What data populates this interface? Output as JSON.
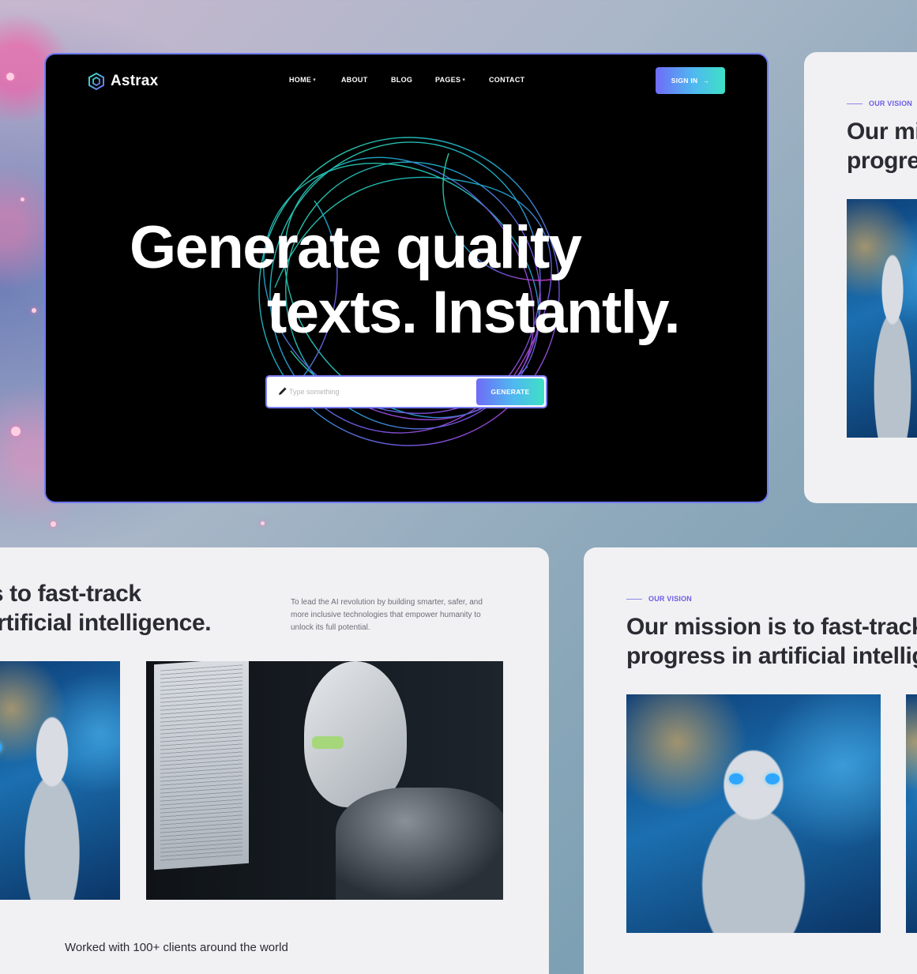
{
  "hero": {
    "brand": "Astrax",
    "nav": {
      "home": "HOME",
      "about": "ABOUT",
      "blog": "BLOG",
      "pages": "PAGES",
      "contact": "CONTACT"
    },
    "signin_label": "SIGN IN",
    "title_line1": "Generate quality",
    "title_line2": "texts. Instantly.",
    "input_placeholder": "Type something",
    "generate_label": "GENERATE"
  },
  "card_right_top": {
    "eyebrow": "OUR VISION",
    "heading_line1": "Our mi",
    "heading_line2": "progre"
  },
  "card_bottom_left": {
    "heading_line1": "is to fast-track",
    "heading_line2": "artificial intelligence.",
    "description": "To lead the AI revolution by building smarter, safer, and more inclusive technologies that empower humanity to unlock its full potential.",
    "clients_text": "Worked with 100+ clients around the world"
  },
  "card_bottom_right": {
    "eyebrow": "OUR VISION",
    "heading_line1": "Our mission is to fast-track",
    "heading_line2": "progress in artificial intellig"
  },
  "icons": {
    "logo": "hexagon-logo-icon",
    "arrow": "arrow-right-icon",
    "pencil": "pencil-icon",
    "chevron": "chevron-down-icon"
  },
  "colors": {
    "accent": "#6c5ce7",
    "gradient_start": "#6f6cf7",
    "gradient_end": "#3fe0c6",
    "hero_bg": "#000000",
    "card_bg": "#f1f1f3"
  }
}
